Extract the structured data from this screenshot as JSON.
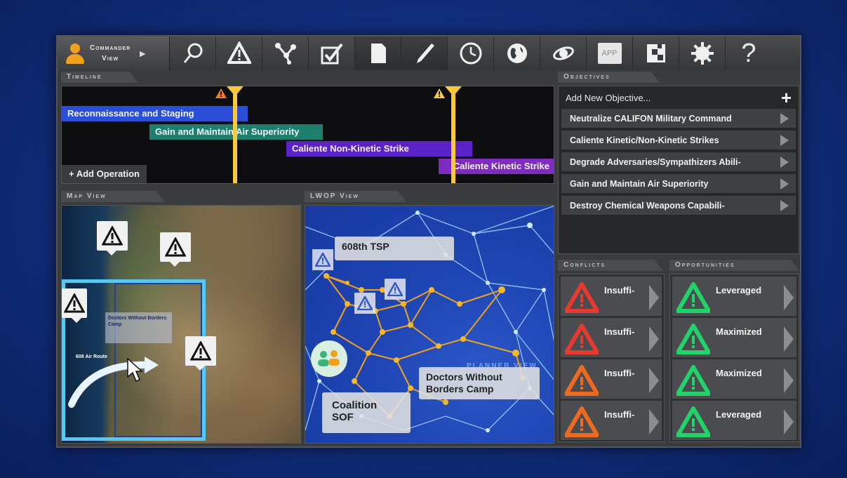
{
  "toolbar": {
    "commander_line1": "Commander",
    "commander_line2": "View",
    "app_label": "APP",
    "help_label": "?"
  },
  "sections": {
    "timeline": "Timeline",
    "objectives": "Objectives",
    "map_view": "Map View",
    "lwop_view": "LWOP View",
    "conflicts": "Conflicts",
    "opportunities": "Opportunities"
  },
  "timeline": {
    "bars": [
      {
        "label": "Reconnaissance and Staging",
        "color": "#2a4fd6"
      },
      {
        "label": "Gain and Maintain Air Superiority",
        "color": "#1f7f6f"
      },
      {
        "label": "Caliente Non-Kinetic Strike",
        "color": "#5a22c7"
      },
      {
        "label": "Caliente Kinetic Strike",
        "color": "#7e2bc2"
      }
    ],
    "add_operation": "+ Add Operation"
  },
  "objectives": {
    "add_new": "Add New Objective...",
    "add_icon": "plus-icon",
    "items": [
      "Neutralize CALIFON Military Command",
      "Caliente Kinetic/Non-Kinetic Strikes",
      "Degrade Adversaries/Sympathizers Abili-",
      "Gain and Maintain Air Superiority",
      "Destroy Chemical Weapons Capabili-"
    ]
  },
  "map": {
    "camp_label": "Doctors Without Borders Camp",
    "arc_label": "608 Air Route"
  },
  "lwop": {
    "tsp_label": "608th TSP",
    "camp_label": "Doctors Without Borders Camp",
    "sof_label": "Coalition SOF",
    "planner_label": "PLANNER VIEW"
  },
  "conflicts": {
    "items": [
      {
        "label": "Insuffi-",
        "color": "#e63a2e"
      },
      {
        "label": "Insuffi-",
        "color": "#e63a2e"
      },
      {
        "label": "Insuffi-",
        "color": "#ef6a1f"
      },
      {
        "label": "Insuffi-",
        "color": "#ef6a1f"
      }
    ]
  },
  "opportunities": {
    "items": [
      {
        "label": "Leveraged",
        "color": "#22d36a"
      },
      {
        "label": "Maximized",
        "color": "#22d36a"
      },
      {
        "label": "Maximized",
        "color": "#22d36a"
      },
      {
        "label": "Leveraged",
        "color": "#22d36a"
      }
    ]
  },
  "colors": {
    "timeline_marker": "#f8c93a",
    "map_border": "#58c8f2",
    "network_edge": "#f0a020",
    "network_edge_light": "#9ed2ff"
  }
}
